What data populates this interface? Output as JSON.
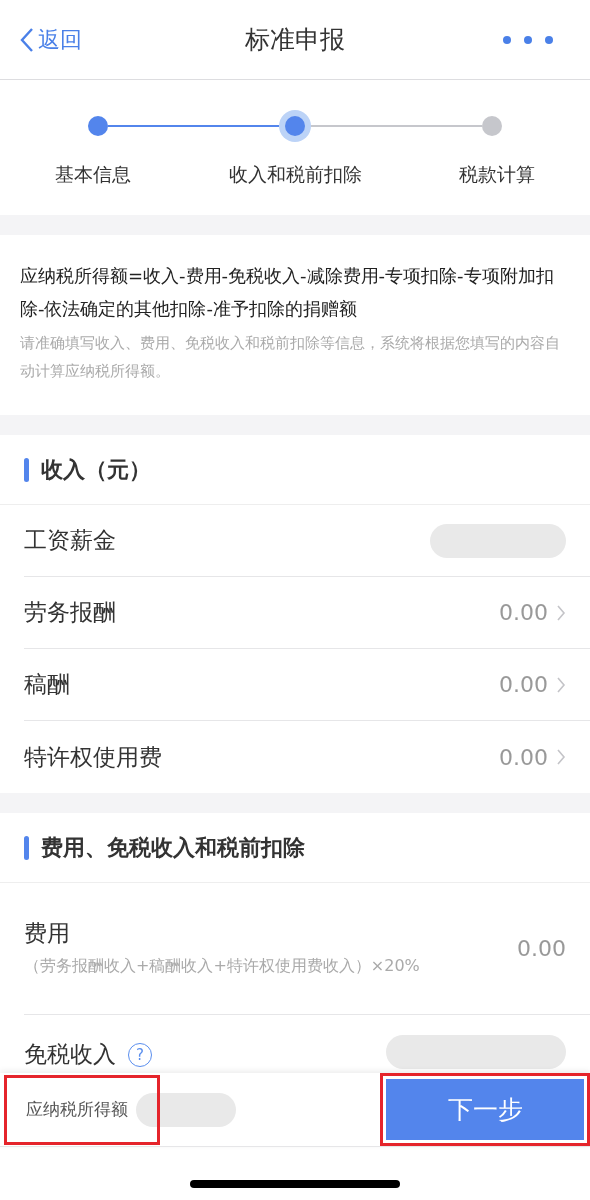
{
  "nav": {
    "back": "返回",
    "title": "标准申报"
  },
  "steps": [
    {
      "label": "基本信息",
      "completed": true,
      "selected": false
    },
    {
      "label": "收入和税前扣除",
      "completed": false,
      "selected": true
    },
    {
      "label": "税款计算",
      "completed": false,
      "selected": false
    }
  ],
  "formula": {
    "text": "应纳税所得额=收入-费用-免税收入-减除费用-专项扣除-专项附加扣除-依法确定的其他扣除-准予扣除的捐赠额",
    "hint": "请准确填写收入、费用、免税收入和税前扣除等信息，系统将根据您填写的内容自动计算应纳税所得额。"
  },
  "income": {
    "title": "收入（元）",
    "rows": [
      {
        "label": "工资薪金",
        "redacted": true
      },
      {
        "label": "劳务报酬",
        "value": "0.00"
      },
      {
        "label": "稿酬",
        "value": "0.00"
      },
      {
        "label": "特许权使用费",
        "value": "0.00"
      }
    ]
  },
  "deductions": {
    "title": "费用、免税收入和税前扣除",
    "rows": [
      {
        "kind": "formula",
        "label": "费用",
        "note": "（劳务报酬收入+稿酬收入+特许权使用费收入）×20%",
        "value": "0.00"
      },
      {
        "kind": "help",
        "label": "免税收入",
        "help": "?",
        "redacted": true
      }
    ]
  },
  "footer": {
    "label": "应纳税所得额",
    "redacted": true,
    "label_highlighted": true,
    "button": "下一步",
    "button_highlighted": true
  }
}
